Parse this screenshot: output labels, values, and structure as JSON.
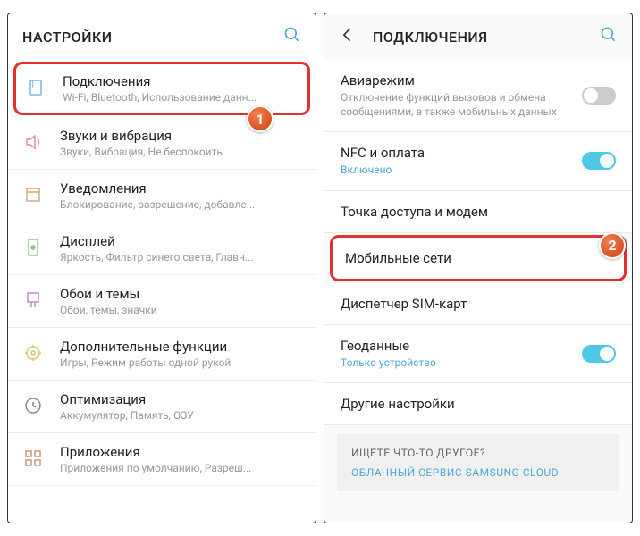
{
  "left": {
    "title": "НАСТРОЙКИ",
    "badge": "1",
    "items": [
      {
        "title": "Подключения",
        "sub": "Wi-Fi, Bluetooth, Использование данн..."
      },
      {
        "title": "Звуки и вибрация",
        "sub": "Звуки, Вибрация, Не беспокоить"
      },
      {
        "title": "Уведомления",
        "sub": "Блокирование, разрешение, добавле..."
      },
      {
        "title": "Дисплей",
        "sub": "Яркость, Фильтр синего света, Главн..."
      },
      {
        "title": "Обои и темы",
        "sub": "Обои, темы, значки"
      },
      {
        "title": "Дополнительные функции",
        "sub": "Игры, Режим работы одной рукой"
      },
      {
        "title": "Оптимизация",
        "sub": "Аккумулятор, Память, ОЗУ"
      },
      {
        "title": "Приложения",
        "sub": "Приложения по умолчанию, Разреш..."
      }
    ]
  },
  "right": {
    "title": "ПОДКЛЮЧЕНИЯ",
    "badge": "2",
    "items": [
      {
        "title": "Авиарежим",
        "sub": "Отключение функций вызовов и обмена сообщениями, а также мобильных данных",
        "toggle": false
      },
      {
        "title": "NFC и оплата",
        "sub": "Включено",
        "blue": true,
        "toggle": true
      },
      {
        "title": "Точка доступа и модем"
      },
      {
        "title": "Мобильные сети"
      },
      {
        "title": "Диспетчер SIM-карт"
      },
      {
        "title": "Геоданные",
        "sub": "Только устройство",
        "blue": true,
        "toggle": true
      },
      {
        "title": "Другие настройки"
      }
    ],
    "footer_q": "ИЩЕТЕ ЧТО-ТО ДРУГОЕ?",
    "footer_link": "ОБЛАЧНЫЙ СЕРВИС SAMSUNG CLOUD"
  }
}
